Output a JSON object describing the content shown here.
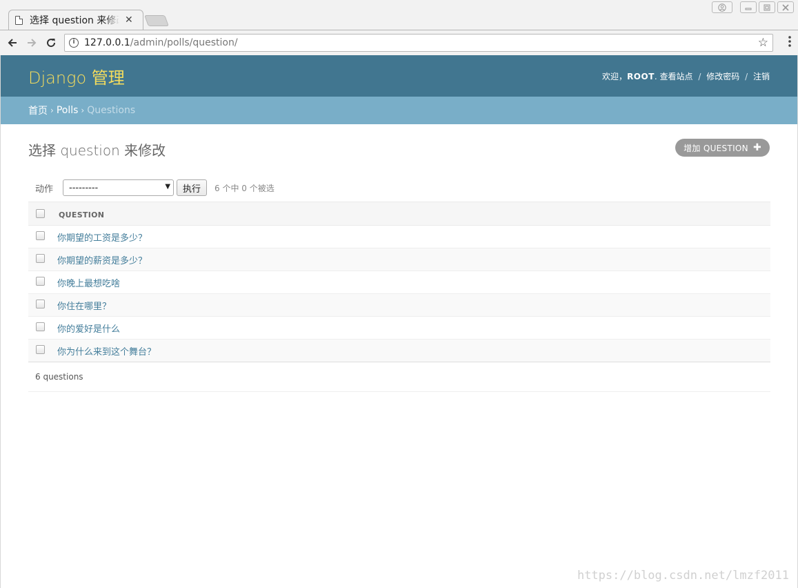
{
  "browser": {
    "tab_title": "选择 question 来修改",
    "tab_close": "✕",
    "url_host": "127.0.0.1",
    "url_path": "/admin/polls/question/"
  },
  "header": {
    "branding": "Django 管理",
    "welcome": "欢迎，",
    "username": "ROOT",
    "period": ".",
    "view_site": "查看站点",
    "change_password": "修改密码",
    "logout": "注销",
    "separator": "/"
  },
  "breadcrumbs": {
    "home": "首页",
    "app": "Polls",
    "current": "Questions",
    "arrow": "›"
  },
  "main": {
    "title": "选择 question 来修改",
    "add_button": "增加 QUESTION",
    "actions_label": "动作",
    "action_select_value": "---------",
    "go_button": "执行",
    "selected_count": "6 个中 0 个被选",
    "column_header": "QUESTION",
    "rows": [
      "你期望的工资是多少？",
      "你期望的薪资是多少？",
      "你晚上最想吃啥",
      "你住在哪里？",
      "你的爱好是什么",
      "你为什么来到这个舞台？"
    ],
    "paginator": "6 questions"
  },
  "watermark": "https://blog.csdn.net/lmzf2011",
  "colors": {
    "header_bg": "#417690",
    "branding": "#f5dd5d",
    "breadcrumbs_bg": "#79aec8",
    "link": "#447e9b",
    "add_button_bg": "#999999"
  }
}
